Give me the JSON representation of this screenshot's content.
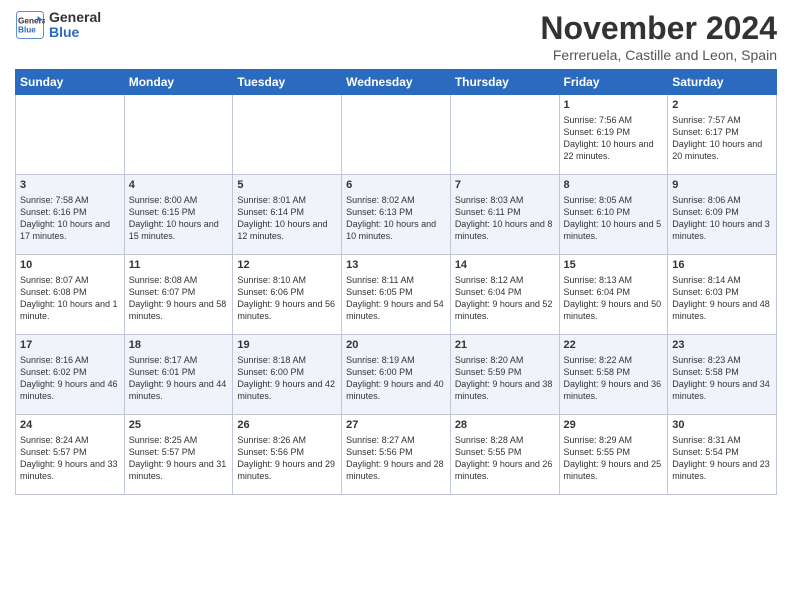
{
  "header": {
    "logo_line1": "General",
    "logo_line2": "Blue",
    "month": "November 2024",
    "location": "Ferreruela, Castille and Leon, Spain"
  },
  "weekdays": [
    "Sunday",
    "Monday",
    "Tuesday",
    "Wednesday",
    "Thursday",
    "Friday",
    "Saturday"
  ],
  "weeks": [
    [
      {
        "day": "",
        "info": ""
      },
      {
        "day": "",
        "info": ""
      },
      {
        "day": "",
        "info": ""
      },
      {
        "day": "",
        "info": ""
      },
      {
        "day": "",
        "info": ""
      },
      {
        "day": "1",
        "info": "Sunrise: 7:56 AM\nSunset: 6:19 PM\nDaylight: 10 hours and 22 minutes."
      },
      {
        "day": "2",
        "info": "Sunrise: 7:57 AM\nSunset: 6:17 PM\nDaylight: 10 hours and 20 minutes."
      }
    ],
    [
      {
        "day": "3",
        "info": "Sunrise: 7:58 AM\nSunset: 6:16 PM\nDaylight: 10 hours and 17 minutes."
      },
      {
        "day": "4",
        "info": "Sunrise: 8:00 AM\nSunset: 6:15 PM\nDaylight: 10 hours and 15 minutes."
      },
      {
        "day": "5",
        "info": "Sunrise: 8:01 AM\nSunset: 6:14 PM\nDaylight: 10 hours and 12 minutes."
      },
      {
        "day": "6",
        "info": "Sunrise: 8:02 AM\nSunset: 6:13 PM\nDaylight: 10 hours and 10 minutes."
      },
      {
        "day": "7",
        "info": "Sunrise: 8:03 AM\nSunset: 6:11 PM\nDaylight: 10 hours and 8 minutes."
      },
      {
        "day": "8",
        "info": "Sunrise: 8:05 AM\nSunset: 6:10 PM\nDaylight: 10 hours and 5 minutes."
      },
      {
        "day": "9",
        "info": "Sunrise: 8:06 AM\nSunset: 6:09 PM\nDaylight: 10 hours and 3 minutes."
      }
    ],
    [
      {
        "day": "10",
        "info": "Sunrise: 8:07 AM\nSunset: 6:08 PM\nDaylight: 10 hours and 1 minute."
      },
      {
        "day": "11",
        "info": "Sunrise: 8:08 AM\nSunset: 6:07 PM\nDaylight: 9 hours and 58 minutes."
      },
      {
        "day": "12",
        "info": "Sunrise: 8:10 AM\nSunset: 6:06 PM\nDaylight: 9 hours and 56 minutes."
      },
      {
        "day": "13",
        "info": "Sunrise: 8:11 AM\nSunset: 6:05 PM\nDaylight: 9 hours and 54 minutes."
      },
      {
        "day": "14",
        "info": "Sunrise: 8:12 AM\nSunset: 6:04 PM\nDaylight: 9 hours and 52 minutes."
      },
      {
        "day": "15",
        "info": "Sunrise: 8:13 AM\nSunset: 6:04 PM\nDaylight: 9 hours and 50 minutes."
      },
      {
        "day": "16",
        "info": "Sunrise: 8:14 AM\nSunset: 6:03 PM\nDaylight: 9 hours and 48 minutes."
      }
    ],
    [
      {
        "day": "17",
        "info": "Sunrise: 8:16 AM\nSunset: 6:02 PM\nDaylight: 9 hours and 46 minutes."
      },
      {
        "day": "18",
        "info": "Sunrise: 8:17 AM\nSunset: 6:01 PM\nDaylight: 9 hours and 44 minutes."
      },
      {
        "day": "19",
        "info": "Sunrise: 8:18 AM\nSunset: 6:00 PM\nDaylight: 9 hours and 42 minutes."
      },
      {
        "day": "20",
        "info": "Sunrise: 8:19 AM\nSunset: 6:00 PM\nDaylight: 9 hours and 40 minutes."
      },
      {
        "day": "21",
        "info": "Sunrise: 8:20 AM\nSunset: 5:59 PM\nDaylight: 9 hours and 38 minutes."
      },
      {
        "day": "22",
        "info": "Sunrise: 8:22 AM\nSunset: 5:58 PM\nDaylight: 9 hours and 36 minutes."
      },
      {
        "day": "23",
        "info": "Sunrise: 8:23 AM\nSunset: 5:58 PM\nDaylight: 9 hours and 34 minutes."
      }
    ],
    [
      {
        "day": "24",
        "info": "Sunrise: 8:24 AM\nSunset: 5:57 PM\nDaylight: 9 hours and 33 minutes."
      },
      {
        "day": "25",
        "info": "Sunrise: 8:25 AM\nSunset: 5:57 PM\nDaylight: 9 hours and 31 minutes."
      },
      {
        "day": "26",
        "info": "Sunrise: 8:26 AM\nSunset: 5:56 PM\nDaylight: 9 hours and 29 minutes."
      },
      {
        "day": "27",
        "info": "Sunrise: 8:27 AM\nSunset: 5:56 PM\nDaylight: 9 hours and 28 minutes."
      },
      {
        "day": "28",
        "info": "Sunrise: 8:28 AM\nSunset: 5:55 PM\nDaylight: 9 hours and 26 minutes."
      },
      {
        "day": "29",
        "info": "Sunrise: 8:29 AM\nSunset: 5:55 PM\nDaylight: 9 hours and 25 minutes."
      },
      {
        "day": "30",
        "info": "Sunrise: 8:31 AM\nSunset: 5:54 PM\nDaylight: 9 hours and 23 minutes."
      }
    ]
  ]
}
